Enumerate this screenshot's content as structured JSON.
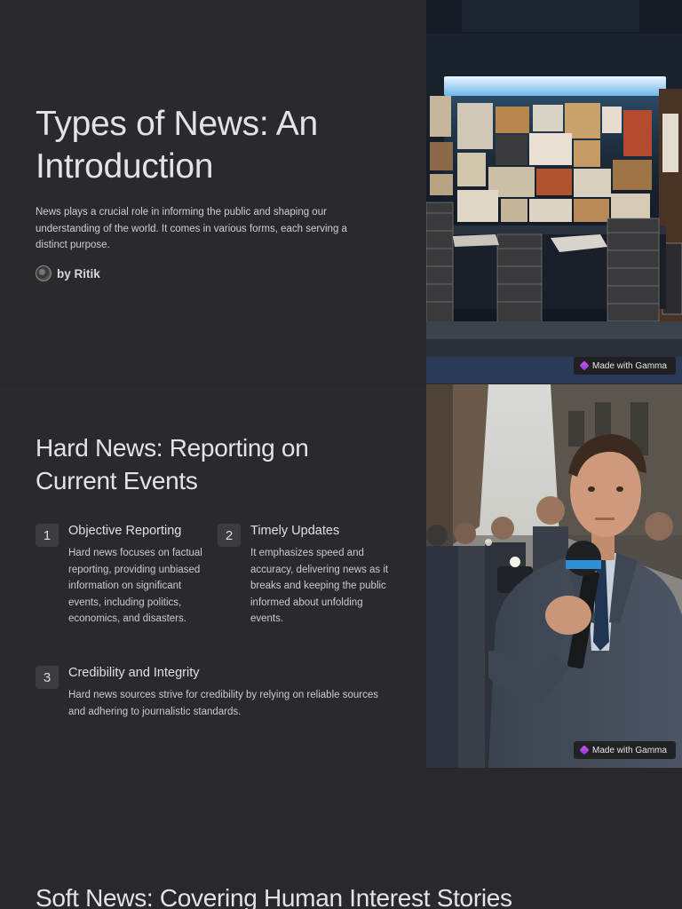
{
  "slide1": {
    "title_line1": "Types of News: An",
    "title_line2": "Introduction",
    "lead": "News plays a crucial role in informing the public and shaping our understanding of the world. It comes in various forms, each serving a distinct purpose.",
    "author": "by Ritik",
    "made_with": "Made with Gamma"
  },
  "slide2": {
    "title_line1": "Hard News: Reporting on",
    "title_line2": "Current Events",
    "features": [
      {
        "number": "1",
        "title": "Objective Reporting",
        "body": "Hard news focuses on factual reporting, providing unbiased information on significant events, including politics, economics, and disasters."
      },
      {
        "number": "2",
        "title": "Timely Updates",
        "body": "It emphasizes speed and accuracy, delivering news as it breaks and keeping the public informed about unfolding events."
      },
      {
        "number": "3",
        "title": "Credibility and Integrity",
        "body": "Hard news sources strive for credibility by relying on reliable sources and adhering to journalistic standards."
      }
    ],
    "made_with": "Made with Gamma"
  },
  "slide3": {
    "title": "Soft News: Covering Human Interest Stories"
  },
  "colors": {
    "background": "#272729",
    "slide": "#2a2a2c",
    "badge": "#3c3c3f",
    "text": "#d6d6d8"
  }
}
